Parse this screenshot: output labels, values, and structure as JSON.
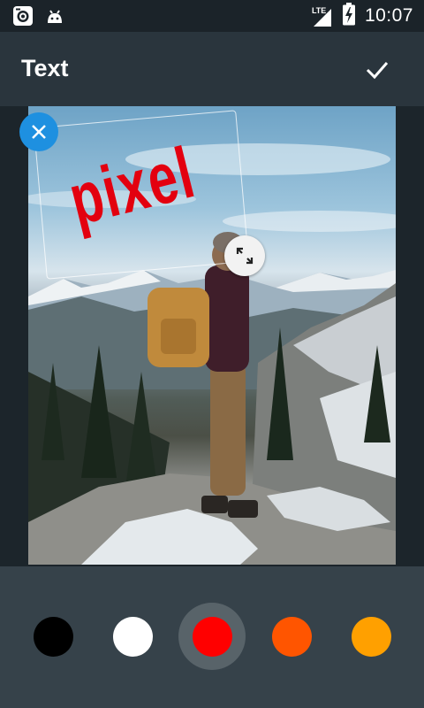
{
  "status_bar": {
    "time": "10:07",
    "network": "LTE",
    "icons": [
      "camera-app-icon",
      "android-icon",
      "signal-icon",
      "battery-charging-icon"
    ]
  },
  "app_bar": {
    "title": "Text",
    "confirm_icon": "check-icon"
  },
  "sticker": {
    "text": "pixel",
    "color": "#e3000f",
    "close_icon": "close-icon",
    "resize_icon": "resize-icon"
  },
  "palette": {
    "colors": [
      "#000000",
      "#ffffff",
      "#ff0000",
      "#ff5500",
      "#ffa000"
    ],
    "selected_color": "#ff0000"
  }
}
